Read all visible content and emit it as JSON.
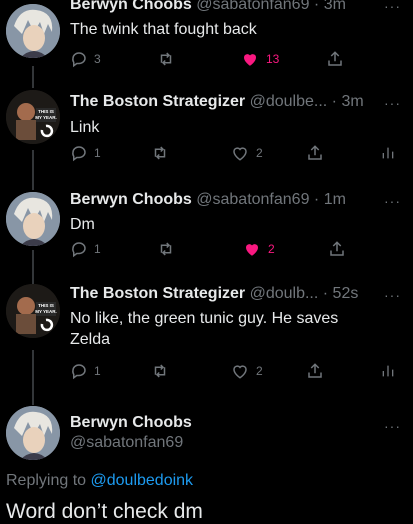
{
  "tweets": [
    {
      "name": "Berwyn Choobs",
      "handle": "@sabatonfan69",
      "time": "· 3m",
      "text": "The twink that fought back",
      "replies": "3",
      "retweets": "",
      "likes": "13",
      "liked": true,
      "avatar": "anime-character-avatar"
    },
    {
      "name": "The Boston Strategizer",
      "handle": "@doulbe...",
      "time": "· 3m",
      "text": "Link",
      "replies": "1",
      "retweets": "",
      "likes": "2",
      "liked": false,
      "avatar": "meme-avatar",
      "avatar_text": "THIS IS MY YEAR."
    },
    {
      "name": "Berwyn Choobs",
      "handle": "@sabatonfan69",
      "time": "· 1m",
      "text": "Dm",
      "replies": "1",
      "retweets": "",
      "likes": "2",
      "liked": true,
      "avatar": "anime-character-avatar"
    },
    {
      "name": "The Boston Strategizer",
      "handle": "@doulb...",
      "time": "· 52s",
      "text_line1": "No like, the green tunic guy. He saves",
      "text_line2": "Zelda",
      "replies": "1",
      "retweets": "",
      "likes": "2",
      "liked": false,
      "avatar": "meme-avatar",
      "avatar_text": "THIS IS MY YEAR."
    }
  ],
  "final": {
    "name": "Berwyn Choobs",
    "handle": "@sabatonfan69",
    "replying_prefix": "Replying to",
    "replying_handle": "@doulbedoink",
    "text": "Word don’t check dm"
  },
  "more_label": "···",
  "colors": {
    "background": "#000000",
    "text": "#e7e9ea",
    "muted": "#71767b",
    "like": "#f91880",
    "link": "#1d9bf0"
  }
}
